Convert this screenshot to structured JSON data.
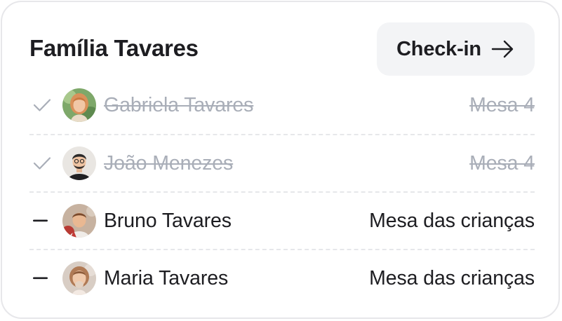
{
  "card": {
    "title": "Família Tavares",
    "checkin_label": "Check-in",
    "checkin_icon": "arrow-right-icon"
  },
  "colors": {
    "text": "#1d1d21",
    "muted": "#a9aeb8",
    "button_bg": "#f3f4f6",
    "border": "#e7e7ea"
  },
  "guests": [
    {
      "name": "Gabriela Tavares",
      "table": "Mesa 4",
      "checked_in": true,
      "status_icon": "check-icon"
    },
    {
      "name": "João Menezes",
      "table": "Mesa 4",
      "checked_in": true,
      "status_icon": "check-icon"
    },
    {
      "name": "Bruno Tavares",
      "table": "Mesa das crianças",
      "checked_in": false,
      "status_icon": "dash-icon"
    },
    {
      "name": "Maria Tavares",
      "table": "Mesa das crianças",
      "checked_in": false,
      "status_icon": "dash-icon"
    }
  ]
}
